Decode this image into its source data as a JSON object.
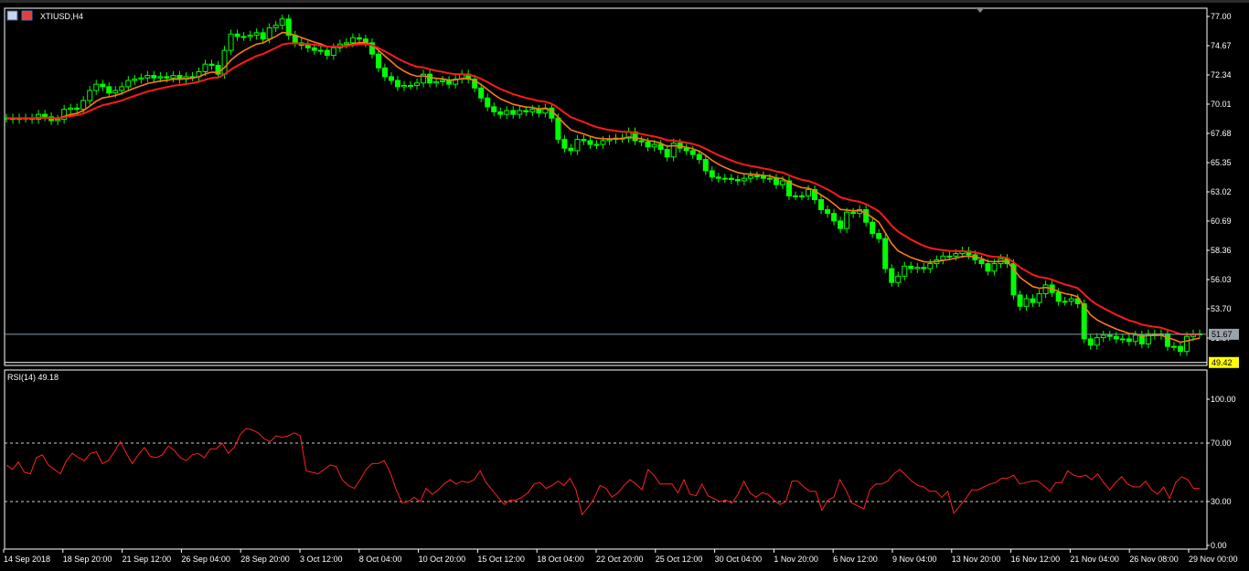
{
  "window": {
    "symbol_label": "XTIUSD,H4",
    "icon": "chart-window-icon"
  },
  "colors": {
    "background": "#000000",
    "grid": "#ffffff",
    "candle_bull": "#00ff00",
    "candle_bear": "#00ff00",
    "ma_fast": "#ff7a1a",
    "ma_slow": "#ff1a1a",
    "rsi_line": "#ff2020",
    "current_price_bg": "#9aa2aa",
    "low_price_bg": "#ffff00",
    "axis_text": "#ffffff"
  },
  "price_panel": {
    "y_ticks": [
      "77.00",
      "74.67",
      "72.34",
      "70.01",
      "67.68",
      "65.35",
      "63.02",
      "60.69",
      "58.36",
      "56.03",
      "53.70",
      "51.37"
    ],
    "current_price_label": "51.67",
    "current_price": 51.67,
    "low_price_label": "49.42",
    "low_price": 49.42
  },
  "rsi_panel": {
    "title": "RSI(14) 49.18",
    "y_ticks": [
      "100.00",
      "70.00",
      "30.00",
      "0.00"
    ],
    "levels": [
      70,
      30
    ]
  },
  "time_axis": {
    "labels": [
      "14 Sep 2018",
      "18 Sep 20:00",
      "21 Sep 12:00",
      "26 Sep 04:00",
      "28 Sep 20:00",
      "3 Oct 12:00",
      "8 Oct 04:00",
      "10 Oct 20:00",
      "15 Oct 12:00",
      "18 Oct 04:00",
      "22 Oct 20:00",
      "25 Oct 12:00",
      "30 Oct 04:00",
      "1 Nov 20:00",
      "6 Nov 12:00",
      "9 Nov 04:00",
      "13 Nov 20:00",
      "16 Nov 12:00",
      "21 Nov 04:00",
      "26 Nov 08:00",
      "29 Nov 00:00"
    ]
  },
  "chart_data": {
    "type": "line",
    "title": "XTIUSD,H4",
    "x_range": [
      "14 Sep 2018",
      "29 Nov 2018"
    ],
    "ylim": [
      49.42,
      77.0
    ],
    "series": [
      {
        "values": [
          68.9,
          68.8,
          68.9,
          68.9,
          68.8,
          69.2,
          69.0,
          68.7,
          68.8,
          69.6,
          69.7,
          69.6,
          70.3,
          71.1,
          71.6,
          71.4,
          70.9,
          71.1,
          71.4,
          71.9,
          72.0,
          72.1,
          72.3,
          72.1,
          72.2,
          72.1,
          72.3,
          72.0,
          72.2,
          72.2,
          72.6,
          73.2,
          73.1,
          72.4,
          74.3,
          75.6,
          75.4,
          75.4,
          75.5,
          75.7,
          75.2,
          76.1,
          76.3,
          76.8,
          75.5,
          74.9,
          74.7,
          74.5,
          74.3,
          74.3,
          73.9,
          74.5,
          74.8,
          74.9,
          75.3,
          75.2,
          74.9,
          74.0,
          72.9,
          72.2,
          71.9,
          71.4,
          71.5,
          71.5,
          71.7,
          72.4,
          71.7,
          71.8,
          71.9,
          71.6,
          72.0,
          72.4,
          72.0,
          71.3,
          70.5,
          69.8,
          69.4,
          69.2,
          69.5,
          69.2,
          69.5,
          69.4,
          69.6,
          69.3,
          69.7,
          68.9,
          67.2,
          66.5,
          66.3,
          67.2,
          67.1,
          66.8,
          66.8,
          67.1,
          67.2,
          67.3,
          67.3,
          67.8,
          67.1,
          67.0,
          66.6,
          66.8,
          66.4,
          65.8,
          66.9,
          66.5,
          66.3,
          66.0,
          65.6,
          64.7,
          64.2,
          64.1,
          64.1,
          64.0,
          63.9,
          64.1,
          64.3,
          64.3,
          64.1,
          64.1,
          63.6,
          63.9,
          62.7,
          62.7,
          62.7,
          63.2,
          62.4,
          61.6,
          61.3,
          60.7,
          60.1,
          61.4,
          61.3,
          61.6,
          60.6,
          59.7,
          59.3,
          56.9,
          55.8,
          56.3,
          57.1,
          56.9,
          57.0,
          56.9,
          57.3,
          57.6,
          57.9,
          57.9,
          58.1,
          58.3,
          58.0,
          57.6,
          57.3,
          56.7,
          57.3,
          57.7,
          57.3,
          54.8,
          53.9,
          54.5,
          54.2,
          54.9,
          55.6,
          55.0,
          54.3,
          54.3,
          54.5,
          54.1,
          51.3,
          50.8,
          51.4,
          51.6,
          51.5,
          51.3,
          51.3,
          51.1,
          51.6,
          50.9,
          51.7,
          51.6,
          51.7,
          50.7,
          50.7,
          50.3,
          51.5,
          51.7,
          51.7
        ]
      },
      {
        "name": "RSI(14)",
        "values": [
          55,
          52,
          57,
          50,
          49,
          60,
          62,
          55,
          52,
          49,
          58,
          63,
          60,
          58,
          63,
          64,
          56,
          58,
          64,
          71,
          63,
          56,
          62,
          67,
          61,
          60,
          62,
          68,
          65,
          60,
          58,
          62,
          63,
          60,
          66,
          66,
          70,
          63,
          67,
          76,
          80,
          79,
          77,
          73,
          71,
          75,
          74,
          75,
          77,
          75,
          51,
          50,
          49,
          52,
          55,
          54,
          45,
          41,
          39,
          45,
          52,
          56,
          56,
          58,
          50,
          38,
          29,
          30,
          33,
          30,
          39,
          35,
          38,
          42,
          45,
          42,
          44,
          43,
          45,
          51,
          43,
          38,
          33,
          28,
          31,
          31,
          33,
          36,
          42,
          43,
          39,
          41,
          44,
          41,
          46,
          38,
          21,
          26,
          32,
          41,
          39,
          33,
          36,
          41,
          45,
          42,
          38,
          52,
          48,
          42,
          42,
          42,
          36,
          45,
          35,
          34,
          42,
          34,
          32,
          30,
          31,
          29,
          35,
          44,
          36,
          33,
          36,
          35,
          31,
          28,
          30,
          44,
          44,
          40,
          37,
          37,
          24,
          31,
          33,
          45,
          38,
          29,
          27,
          25,
          38,
          42,
          42,
          44,
          49,
          52,
          48,
          44,
          41,
          40,
          37,
          37,
          33,
          37,
          22,
          27,
          32,
          38,
          38,
          40,
          42,
          43,
          46,
          46,
          48,
          42,
          43,
          44,
          44,
          41,
          37,
          43,
          43,
          51,
          48,
          47,
          48,
          45,
          49,
          43,
          38,
          43,
          47,
          42,
          40,
          40,
          44,
          38,
          35,
          40,
          32,
          43,
          47,
          45,
          39,
          39
        ]
      }
    ]
  }
}
